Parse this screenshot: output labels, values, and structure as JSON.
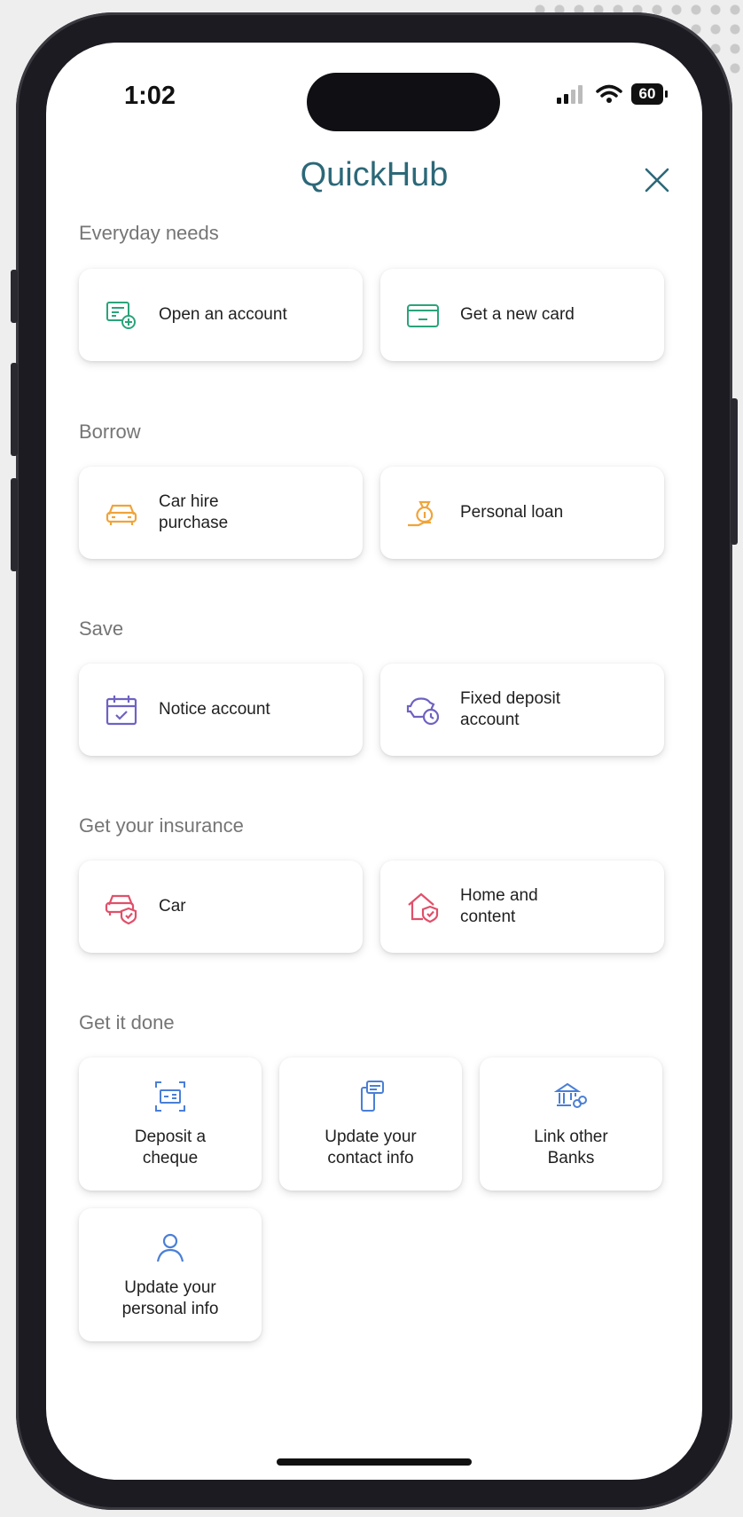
{
  "status": {
    "time": "1:02",
    "battery": "60"
  },
  "header": {
    "title": "QuickHub"
  },
  "sections": [
    {
      "label": "Everyday needs",
      "items": [
        {
          "label": "Open an account",
          "icon": "open-account-icon"
        },
        {
          "label": "Get a new card",
          "icon": "card-icon"
        }
      ]
    },
    {
      "label": "Borrow",
      "items": [
        {
          "label": "Car hire\npurchase",
          "icon": "car-icon"
        },
        {
          "label": "Personal loan",
          "icon": "money-bag-icon"
        }
      ]
    },
    {
      "label": "Save",
      "items": [
        {
          "label": "Notice account",
          "icon": "calendar-icon"
        },
        {
          "label": "Fixed deposit\naccount",
          "icon": "piggy-bank-clock-icon"
        }
      ]
    },
    {
      "label": "Get your insurance",
      "items": [
        {
          "label": "Car",
          "icon": "car-shield-icon"
        },
        {
          "label": "Home and\ncontent",
          "icon": "home-shield-icon"
        }
      ]
    },
    {
      "label": "Get it done",
      "items": [
        {
          "label": "Deposit a\ncheque",
          "icon": "scan-cheque-icon"
        },
        {
          "label": "Update your\ncontact info",
          "icon": "phone-message-icon"
        },
        {
          "label": "Link other\nBanks",
          "icon": "bank-link-icon"
        },
        {
          "label": "Update your\npersonal info",
          "icon": "person-icon"
        }
      ]
    }
  ],
  "colors": {
    "title": "#2c6878",
    "teal_icon": "#2aa37a",
    "borrow_icon": "#f0a43a",
    "save_icon": "#6e62c2",
    "insurance_icon": "#e0506a",
    "done_icon": "#4a7fd6"
  }
}
